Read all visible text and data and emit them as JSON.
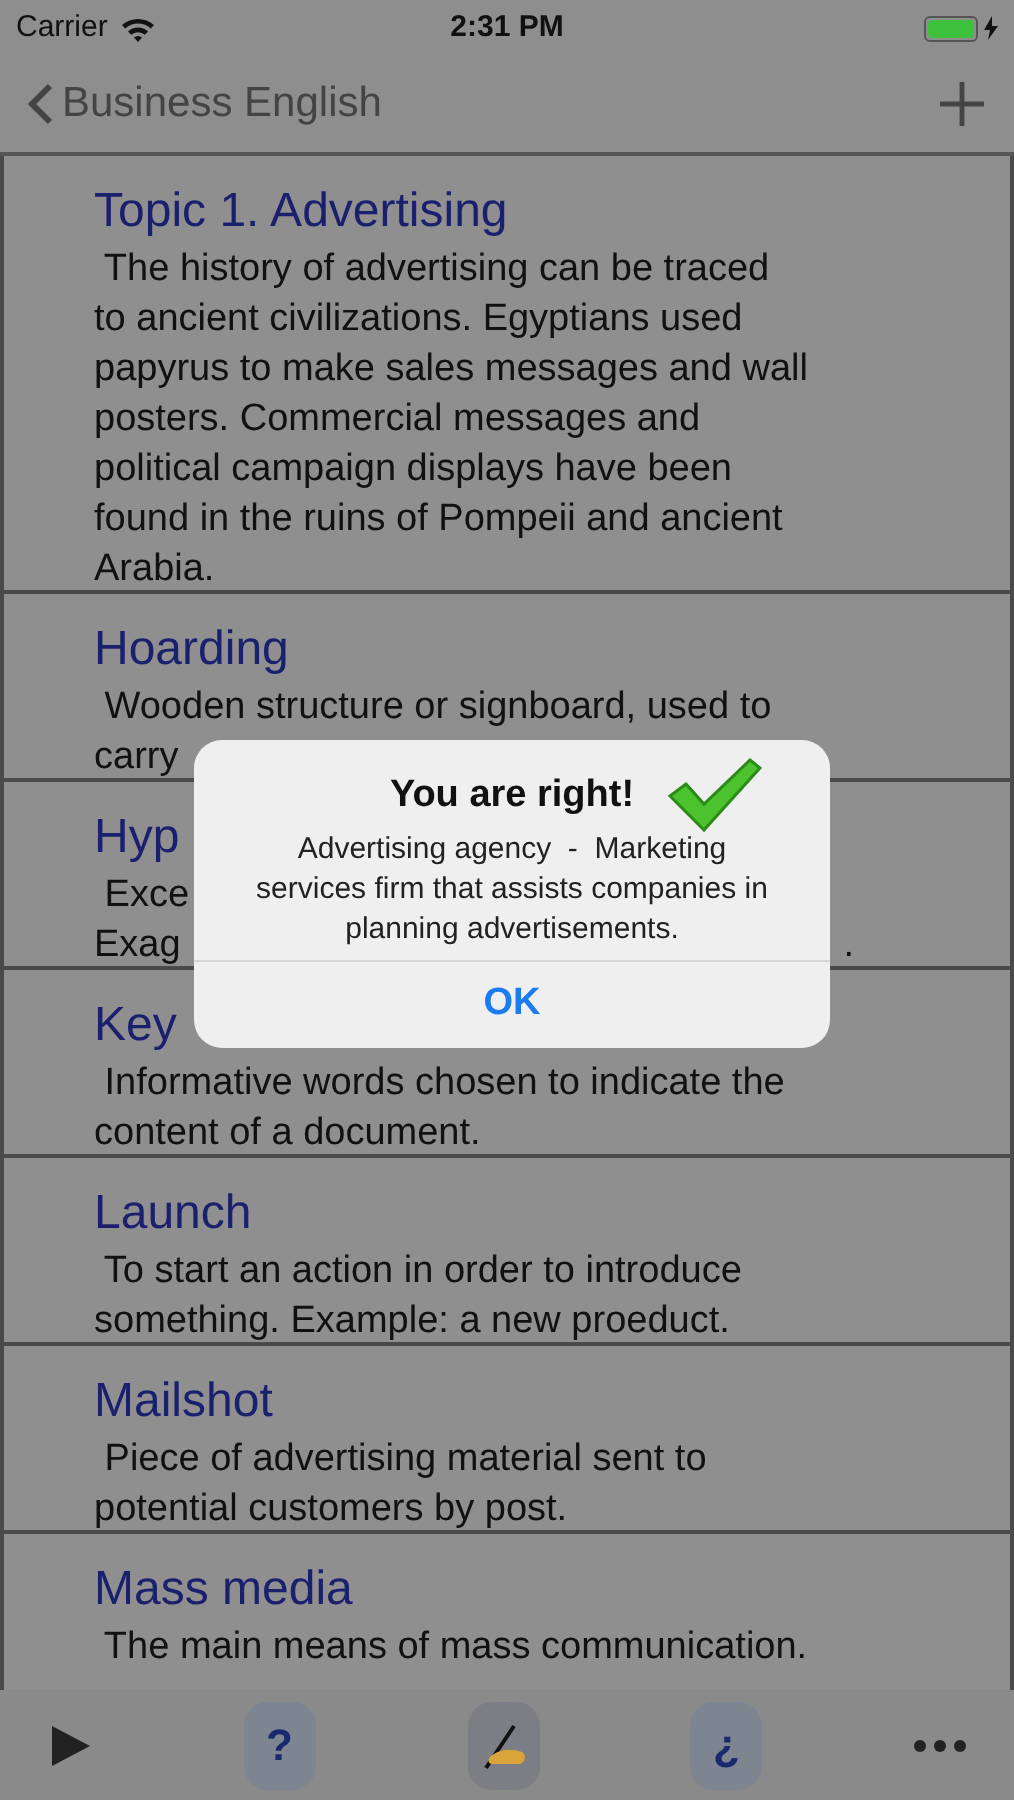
{
  "status_bar": {
    "carrier": "Carrier",
    "time": "2:31 PM",
    "charging": true
  },
  "nav": {
    "back_label": "Business English"
  },
  "rows": [
    {
      "title": "Topic 1. Advertising",
      "lines": [
        {
          "text": " The history of advertising can be traced"
        },
        {
          "text": "to ancient civilizations. Egyptians used"
        },
        {
          "text": "papyrus to make sales messages and wall"
        },
        {
          "text": "posters. Commercial messages and"
        },
        {
          "text": "political campaign displays have been"
        },
        {
          "text": "found in the ruins of Pompeii and ancient"
        },
        {
          "text": "Arabia."
        }
      ]
    },
    {
      "title": "Hoarding",
      "lines": [
        {
          "text": " Wooden structure or signboard, used to"
        },
        {
          "text": "carry"
        }
      ]
    },
    {
      "title": "Hyp",
      "lines": [
        {
          "text": " Exce"
        },
        {
          "text": "Exag",
          "tail": "."
        }
      ]
    },
    {
      "title": "Key",
      "lines": [
        {
          "text": " Informative words chosen to indicate the"
        },
        {
          "text": "content of a document."
        }
      ]
    },
    {
      "title": "Launch",
      "lines": [
        {
          "text": " To start an action in order to introduce"
        },
        {
          "text": "something. Example: a new proeduct."
        }
      ]
    },
    {
      "title": "Mailshot",
      "lines": [
        {
          "text": " Piece of advertising material sent to"
        },
        {
          "text": "potential customers by post."
        }
      ]
    },
    {
      "title": "Mass media",
      "lines": [
        {
          "text": " The main means of mass communication."
        }
      ]
    }
  ],
  "alert": {
    "title": "You are right!",
    "message": "Advertising agency  -  Marketing services firm that assists companies in planning advertisements.",
    "button": "OK"
  },
  "toolbar": [
    {
      "kind": "play"
    },
    {
      "kind": "tile",
      "label": "?"
    },
    {
      "kind": "write"
    },
    {
      "kind": "tile",
      "label": "¿"
    },
    {
      "kind": "more"
    }
  ]
}
